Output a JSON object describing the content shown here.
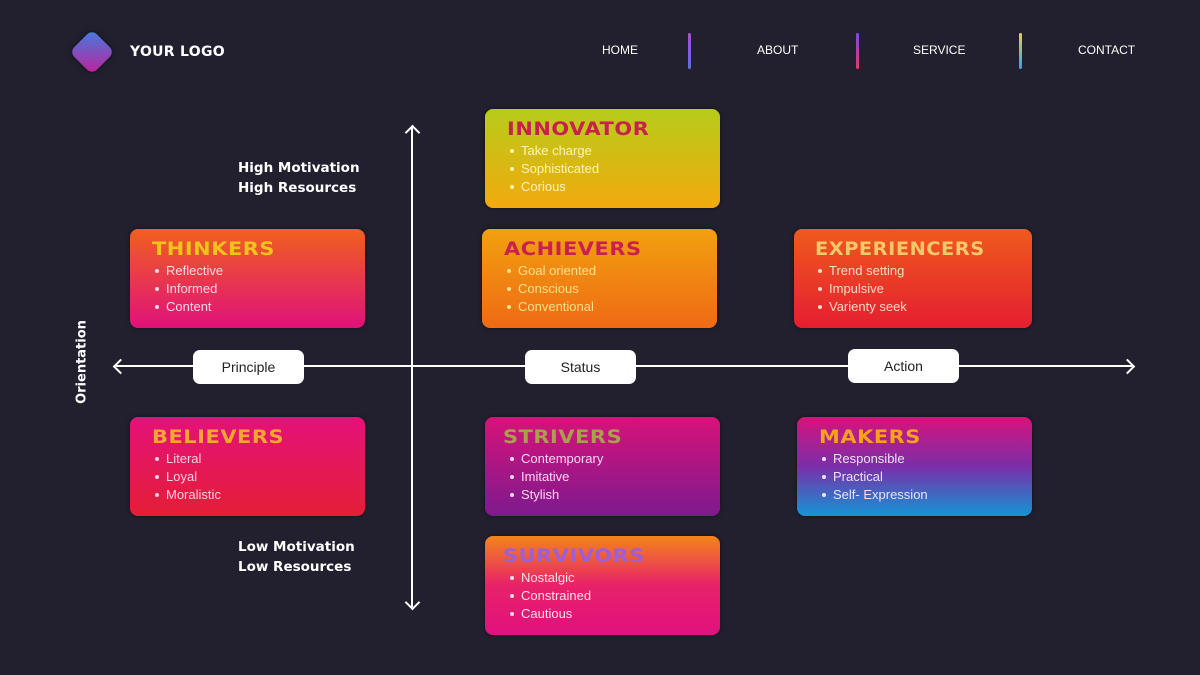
{
  "header": {
    "logo_text": "YOUR LOGO",
    "nav": [
      {
        "label": "HOME"
      },
      {
        "label": "ABOUT"
      },
      {
        "label": "SERVICE"
      },
      {
        "label": "CONTACT"
      }
    ]
  },
  "axes": {
    "vertical_title": "Orientation",
    "top_label_line1": "High Motivation",
    "top_label_line2": "High Resources",
    "bottom_label_line1": "Low Motivation",
    "bottom_label_line2": "Low Resources",
    "horizontal_pills": [
      "Principle",
      "Status",
      "Action"
    ]
  },
  "segments": {
    "innovator": {
      "title": "INNOVATOR",
      "traits": [
        "Take charge",
        "Sophisticated",
        "Corious"
      ],
      "title_color": "#c8214f",
      "text_color": "#fff4b0",
      "gradient": [
        "#b7cc1a",
        "#f2a90e"
      ]
    },
    "thinkers": {
      "title": "THINKERS",
      "traits": [
        "Reflective",
        "Informed",
        "Content"
      ],
      "title_color": "#f2c21c",
      "text_color": "#ffd8e8",
      "gradient": [
        "#f0601e",
        "#e0117a"
      ]
    },
    "achievers": {
      "title": "ACHIEVERS",
      "traits": [
        "Goal oriented",
        "Conscious",
        "Conventional"
      ],
      "title_color": "#c8214f",
      "text_color": "#ffe08a",
      "gradient": [
        "#f2a010",
        "#ef6a14"
      ]
    },
    "experiencers": {
      "title": "EXPERIENCERS",
      "traits": [
        "Trend setting",
        "Impulsive",
        "Varienty seek"
      ],
      "title_color": "#f2c868",
      "text_color": "#ffd8c8",
      "gradient": [
        "#ef5a1e",
        "#e41e30"
      ]
    },
    "believers": {
      "title": "BELIEVERS",
      "traits": [
        "Literal",
        "Loyal",
        "Moralistic"
      ],
      "title_color": "#f2a830",
      "text_color": "#ffd0e0",
      "gradient": [
        "#e4117a",
        "#e41e36"
      ]
    },
    "strivers": {
      "title": "STRIVERS",
      "traits": [
        "Contemporary",
        "Imitative",
        "Stylish"
      ],
      "title_color": "#a8a04a",
      "text_color": "#ffd8f4",
      "gradient": [
        "#d8127a",
        "#7d1a8e"
      ]
    },
    "makers": {
      "title": "MAKERS",
      "traits": [
        "Responsible",
        "Practical",
        "Self- Expression"
      ],
      "title_color": "#f4a21e",
      "text_color": "#f0e0ff",
      "gradient": [
        "#d8127a",
        "#7a2ea8",
        "#1495d4"
      ]
    },
    "survivors": {
      "title": "SURVIVORS",
      "traits": [
        "Nostalgic",
        "Constrained",
        "Cautious"
      ],
      "title_color": "#9d5ed8",
      "text_color": "#ffe0e8",
      "gradient": [
        "#f2851a",
        "#e8216a",
        "#e0117e"
      ]
    }
  }
}
